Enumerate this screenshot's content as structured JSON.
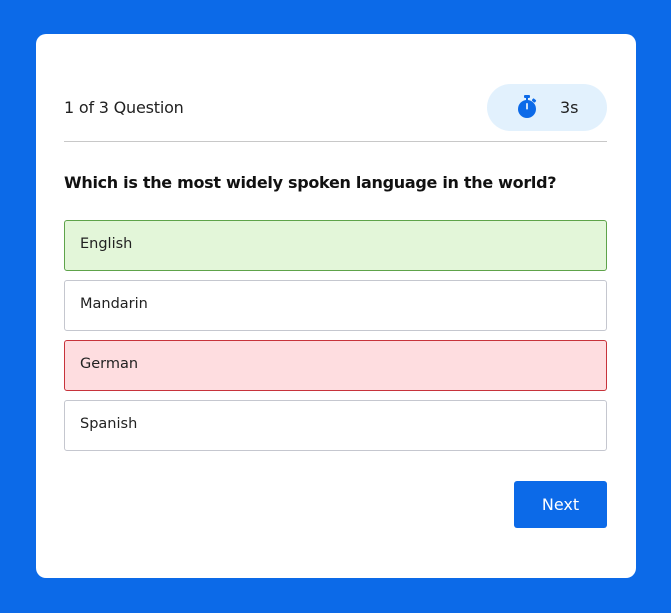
{
  "quiz": {
    "counter": "1 of 3 Question",
    "timer": {
      "icon": "stopwatch-icon",
      "value": "3s",
      "pill_color": "#e2f1fd",
      "icon_color": "#0c6ae8"
    },
    "question": "Which is the most widely spoken language in the world?",
    "options": [
      {
        "label": "English",
        "state": "correct"
      },
      {
        "label": "Mandarin",
        "state": "neutral"
      },
      {
        "label": "German",
        "state": "wrong"
      },
      {
        "label": "Spanish",
        "state": "neutral"
      }
    ],
    "next_label": "Next"
  },
  "colors": {
    "background": "#0c6ae8",
    "card": "#ffffff",
    "correct_fill": "#e3f6d9",
    "correct_border": "#5ea34a",
    "wrong_fill": "#fedde0",
    "wrong_border": "#c7333b",
    "button": "#0c6ae8"
  }
}
